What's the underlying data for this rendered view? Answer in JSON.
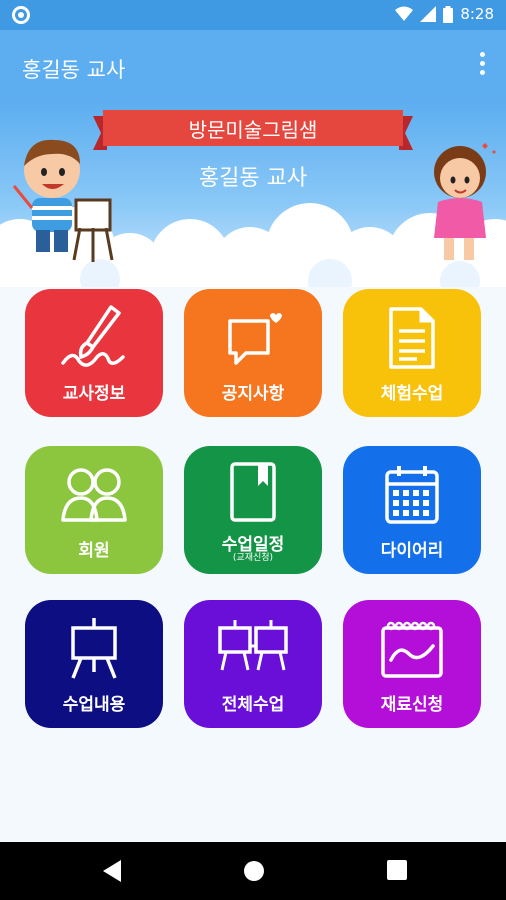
{
  "status_bar": {
    "time": "8:28"
  },
  "app_bar": {
    "title": "홍길동 교사",
    "menu_icon": "more-vert-icon"
  },
  "hero": {
    "banner_title": "방문미술그림샘",
    "teacher_name": "홍길동 교사"
  },
  "tiles": [
    {
      "label": "교사정보",
      "icon": "brush-signature-icon",
      "color": "#e9353e"
    },
    {
      "label": "공지사항",
      "icon": "chat-heart-icon",
      "color": "#f5761e"
    },
    {
      "label": "체험수업",
      "icon": "document-icon",
      "color": "#f9c20a"
    },
    {
      "label": "회원",
      "icon": "people-icon",
      "color": "#8cc63f"
    },
    {
      "label": "수업일정",
      "sub": "(교재신청)",
      "icon": "book-icon",
      "color": "#139447"
    },
    {
      "label": "다이어리",
      "icon": "calendar-icon",
      "color": "#1470ea"
    },
    {
      "label": "수업내용",
      "icon": "easel-icon",
      "color": "#0c0e82"
    },
    {
      "label": "전체수업",
      "icon": "double-easel-icon",
      "color": "#6a0fd8"
    },
    {
      "label": "재료신청",
      "icon": "sketchbook-icon",
      "color": "#b30fd8"
    }
  ]
}
